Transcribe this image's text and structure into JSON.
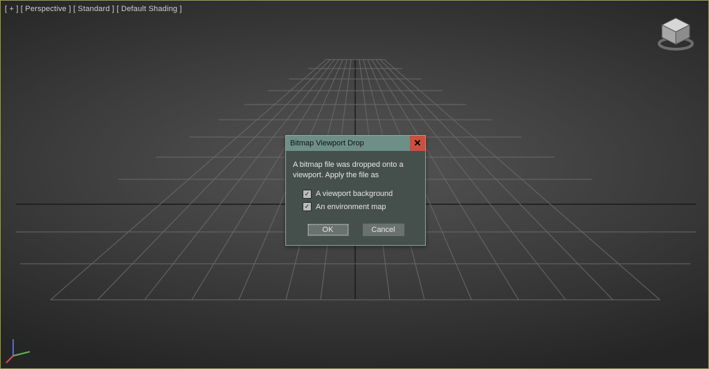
{
  "viewport": {
    "labels": [
      "[ + ]",
      "[ Perspective ]",
      "[ Standard ]",
      "[ Default Shading ]"
    ]
  },
  "dialog": {
    "title": "Bitmap Viewport Drop",
    "message": "A bitmap file was dropped onto a viewport. Apply the file as",
    "options": [
      {
        "label": "A viewport background",
        "checked": true
      },
      {
        "label": "An environment map",
        "checked": true
      }
    ],
    "ok": "OK",
    "cancel": "Cancel",
    "close_glyph": "✕"
  },
  "colors": {
    "axis_x": "#d94f4f",
    "axis_y": "#5fb85f",
    "axis_z": "#4f6fd9"
  }
}
